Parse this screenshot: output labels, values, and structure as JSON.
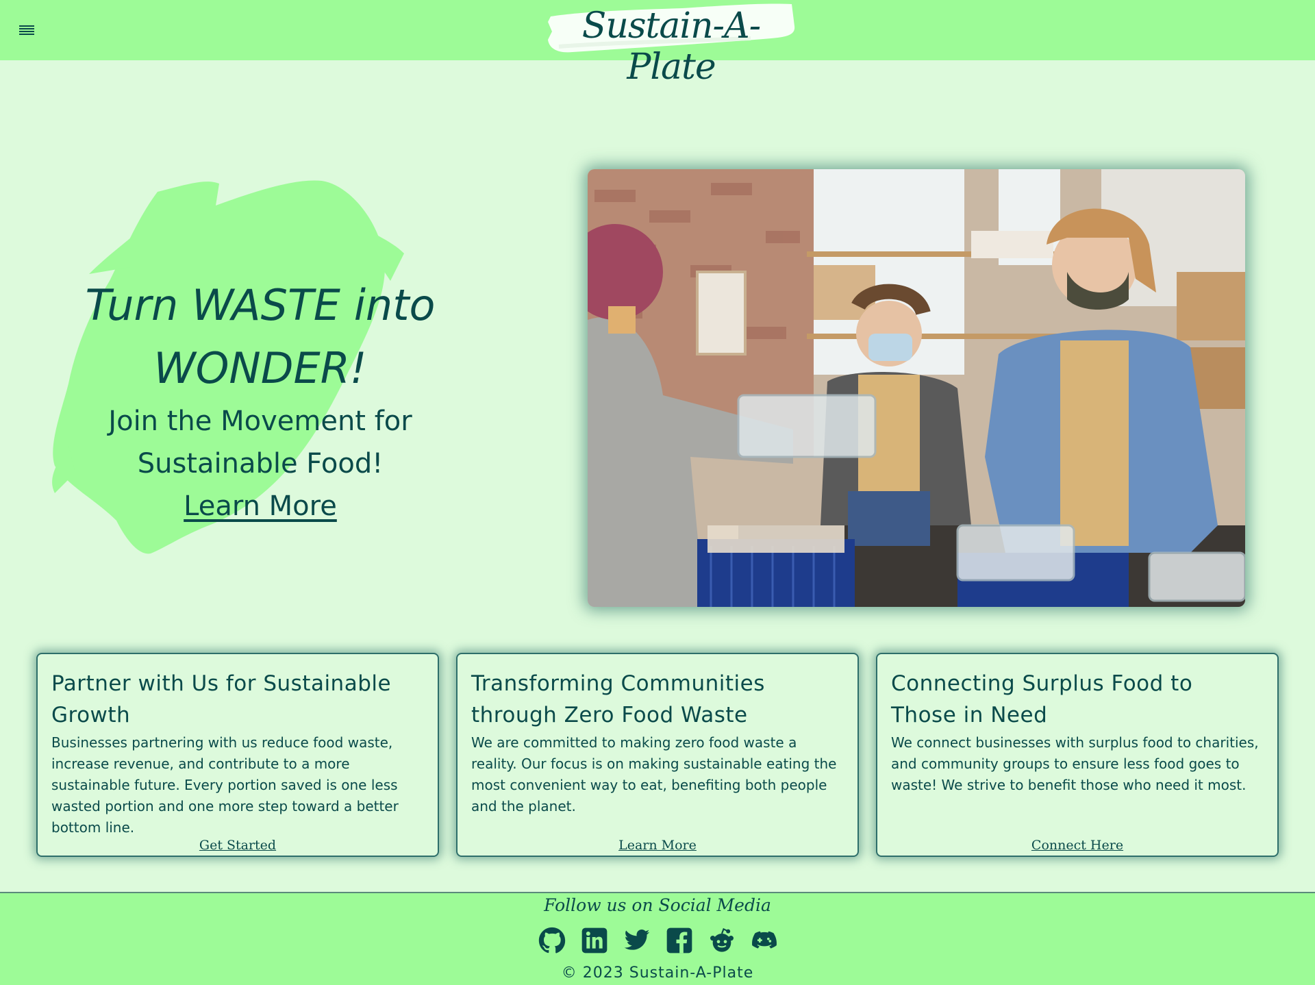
{
  "header": {
    "menu_icon": "hamburger-menu-icon",
    "logo_text": "Sustain-A-Plate"
  },
  "hero": {
    "title": "Turn WASTE into WONDER!",
    "subtitle": "Join the Movement for Sustainable Food!",
    "link_label": "Learn More",
    "photo_description_icon": "volunteers-food-donation-photo"
  },
  "cards": [
    {
      "title": "Partner with Us for Sustainable Growth",
      "body": "Businesses partnering with us reduce food waste, increase revenue, and contribute to a more sustainable future. Every portion saved is one less wasted portion and one more step toward a better bottom line.",
      "link": "Get Started"
    },
    {
      "title": "Transforming Communities through Zero Food Waste",
      "body": "We are committed to making zero food waste a reality. Our focus is on making sustainable eating the most convenient way to eat, benefiting both people and the planet.",
      "link": "Learn More"
    },
    {
      "title": "Connecting Surplus Food to Those in Need",
      "body": "We connect businesses with surplus food to charities, and community groups to ensure less food goes to waste! We strive to benefit those who need it most.",
      "link": "Connect Here"
    }
  ],
  "footer": {
    "follow_text": "Follow us on Social Media",
    "social_icons": [
      "github-icon",
      "linkedin-icon",
      "twitter-icon",
      "facebook-icon",
      "reddit-icon",
      "discord-icon"
    ],
    "copyright": "© 2023 Sustain-A-Plate"
  },
  "colors": {
    "header_bg": "#9dfb97",
    "page_bg": "#ddfadc",
    "text": "#0a4a4a",
    "accent_splash": "#9dfb97"
  }
}
